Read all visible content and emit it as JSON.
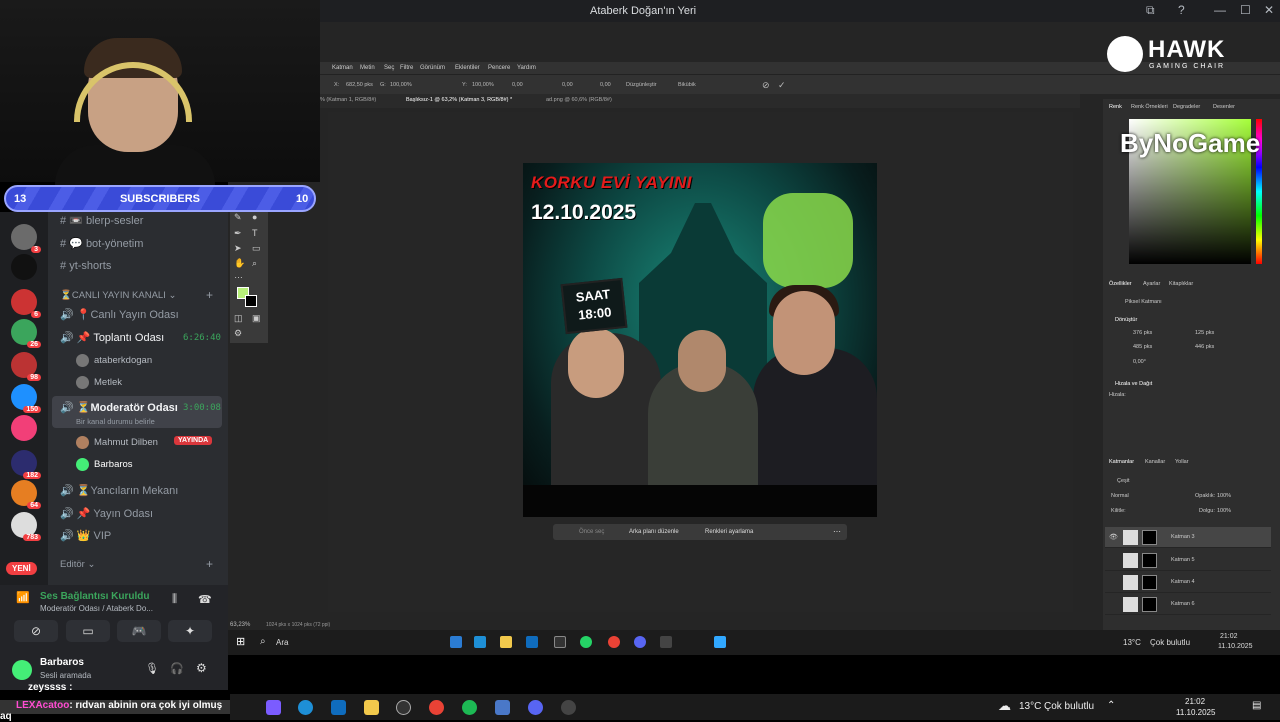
{
  "window": {
    "title": "Ataberk Doğan'ın Yeri",
    "controls": [
      "⧉",
      "?",
      "—",
      "☐",
      "✕"
    ]
  },
  "overlay": {
    "subs_left": "13",
    "subs_label": "SUBSCRIBERS",
    "subs_right": "10",
    "hawk_name": "HAWK",
    "hawk_sub": "GAMING CHAIR",
    "sponsor": "ByNoGame"
  },
  "discord": {
    "server_badges": [
      "3",
      "6",
      "26",
      "98",
      "150",
      "182",
      "64",
      "783"
    ],
    "new_badge": "YENİ",
    "channels": {
      "c1": "blerp-sesler",
      "c2": "bot-yönetim",
      "c3": "yt-shorts",
      "cat1": "CANLI YAYIN KANALI",
      "c4": "Canlı Yayın Odası",
      "c5": "Toplantı Odası",
      "c5_time": "6:26:40",
      "u1": "ataberkdogan",
      "u2": "Metlek",
      "c6": "Moderatör Odası",
      "c6_time": "3:00:08",
      "c6_status": "Bir kanal durumu belirle",
      "u3": "Mahmut Dilben",
      "u3_badge": "YAYINDA",
      "u4": "Barbaros",
      "c7": "Yancıların Mekanı",
      "c8": "Yayın Odası",
      "c9": "VIP",
      "cat2": "Editör"
    },
    "voice": {
      "status": "Ses Bağlantısı Kuruldu",
      "location": "Moderatör Odası / Ataberk Do...",
      "user": "Barbaros",
      "user_status": "Sesli aramada"
    }
  },
  "photoshop": {
    "menu": [
      "Katman",
      "Metin",
      "Seç",
      "Filtre",
      "Görünüm",
      "Eklentiler",
      "Pencere",
      "Yardım"
    ],
    "options": {
      "x": "682,50 pks",
      "w": "100,00%",
      "h": "100,00%",
      "angle": "0,00",
      "hx": "0,00",
      "vy": "0,00",
      "interp": "Düzgünleştir",
      "mode": "Bikübik"
    },
    "tabs": [
      "% (Katman 1, RGB/8#)",
      "Başlıksız-1 @ 63,2% (Katman 3, RGB/8#) *",
      "ad.png @ 60,6% (RGB/8#)"
    ],
    "ctxbar": [
      "Önce seç",
      "Arka planı düzenle",
      "Renkleri ayarlama"
    ],
    "status": {
      "zoom": "63,23%",
      "doc": "1024 pks x 1024 pks (72 ppi)"
    },
    "poster": {
      "title": "KORKU EVİ YAYINI",
      "date": "12.10.2025",
      "saat": "SAAT",
      "time": "18:00"
    },
    "color_tabs": [
      "Renk",
      "Renk Örnekleri",
      "Degradeler",
      "Desenler"
    ],
    "props_tabs": [
      "Özellikler",
      "Ayarlar",
      "Kitaplıklar"
    ],
    "props": {
      "kind": "Piksel Katmanı",
      "transform": "Dönüştür",
      "w": "376 pks",
      "x": "125 pks",
      "h": "485 pks",
      "y": "446 pks",
      "angle": "0,00°",
      "align": "Hizala ve Dağıt",
      "align_sub": "Hizala:"
    },
    "layers_tabs": [
      "Katmanlar",
      "Kanallar",
      "Yollar"
    ],
    "layers_opts": {
      "kind": "Çeşit",
      "blend": "Normal",
      "opacity_label": "Opaklık:",
      "opacity": "100%",
      "lock": "Kilitle:",
      "fill_label": "Dolgu:",
      "fill": "100%"
    },
    "layers": [
      "Katman 3",
      "Katman 5",
      "Katman 4",
      "Katman 6"
    ]
  },
  "inner_taskbar": {
    "search": "Ara",
    "weather": "13°C",
    "weather_desc": "Çok bulutlu",
    "time": "21:02",
    "date": "11.10.2025"
  },
  "chat": {
    "user1": "zeyssss :",
    "user2": "LEXAcatoo",
    "msg2": ": rıdvan abinin ora çok iyi olmuş aq"
  },
  "outer_taskbar": {
    "weather": "13°C",
    "weather_desc": "Çok bulutlu",
    "time": "21:02",
    "date": "11.10.2025"
  }
}
